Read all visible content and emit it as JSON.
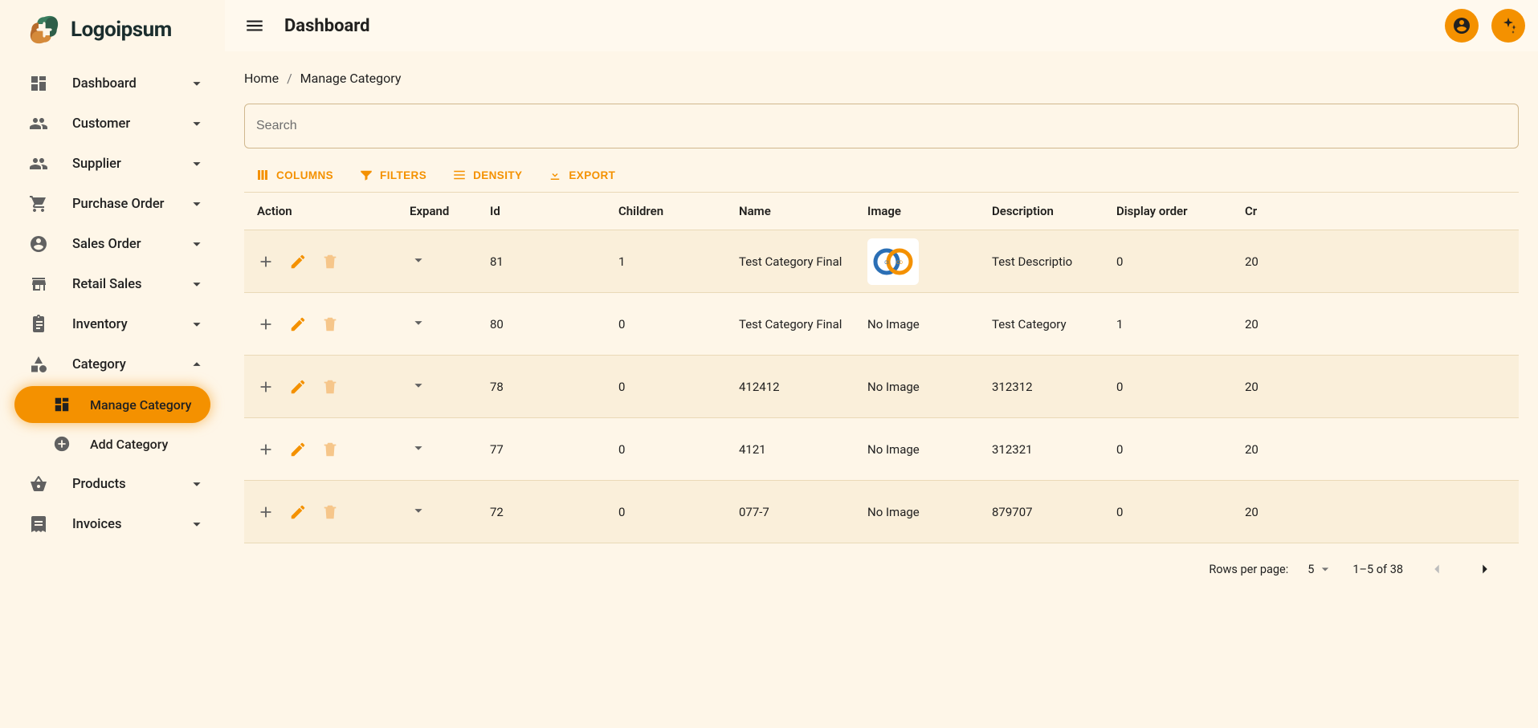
{
  "logo_text": "Logoipsum",
  "header_title": "Dashboard",
  "sidebar": {
    "items": [
      {
        "label": "Dashboard"
      },
      {
        "label": "Customer"
      },
      {
        "label": "Supplier"
      },
      {
        "label": "Purchase Order"
      },
      {
        "label": "Sales Order"
      },
      {
        "label": "Retail Sales"
      },
      {
        "label": "Inventory"
      },
      {
        "label": "Category",
        "expanded": true
      },
      {
        "label": "Products"
      },
      {
        "label": "Invoices"
      }
    ],
    "category_sub": [
      {
        "label": "Manage Category",
        "active": true
      },
      {
        "label": "Add Category"
      }
    ]
  },
  "breadcrumbs": {
    "home": "Home",
    "current": "Manage Category"
  },
  "search": {
    "placeholder": "Search"
  },
  "toolbar": {
    "columns": "COLUMNS",
    "filters": "FILTERS",
    "density": "DENSITY",
    "export": "EXPORT"
  },
  "grid": {
    "headers": {
      "action": "Action",
      "expand": "Expand",
      "id": "Id",
      "children": "Children",
      "name": "Name",
      "image": "Image",
      "description": "Description",
      "display_order": "Display order",
      "created": "Cr"
    },
    "no_image_text": "No Image",
    "rows": [
      {
        "id": "81",
        "children": "1",
        "name": "Test Category Final",
        "has_image": true,
        "description": "Test Descriptio",
        "display_order": "0",
        "created": "20"
      },
      {
        "id": "80",
        "children": "0",
        "name": "Test Category Final",
        "has_image": false,
        "description": "Test Category",
        "display_order": "1",
        "created": "20"
      },
      {
        "id": "78",
        "children": "0",
        "name": "412412",
        "has_image": false,
        "description": "312312",
        "display_order": "0",
        "created": "20"
      },
      {
        "id": "77",
        "children": "0",
        "name": "4121",
        "has_image": false,
        "description": "312321",
        "display_order": "0",
        "created": "20"
      },
      {
        "id": "72",
        "children": "0",
        "name": "077-7",
        "has_image": false,
        "description": "879707",
        "display_order": "0",
        "created": "20"
      }
    ]
  },
  "pagination": {
    "rows_per_page_label": "Rows per page:",
    "rows_per_page_value": "5",
    "range": "1–5 of 38"
  }
}
